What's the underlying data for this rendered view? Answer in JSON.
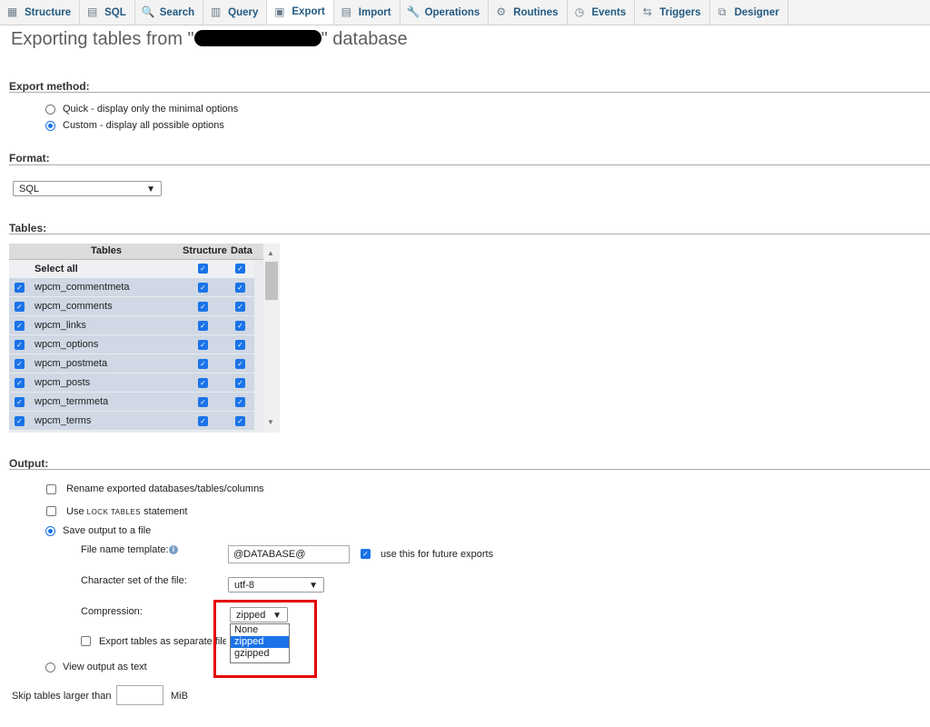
{
  "nav": {
    "tabs": [
      {
        "label": "Structure",
        "icon": "structure-icon",
        "glyph": "▦"
      },
      {
        "label": "SQL",
        "icon": "sql-icon",
        "glyph": "▤"
      },
      {
        "label": "Search",
        "icon": "search-icon",
        "glyph": "🔍"
      },
      {
        "label": "Query",
        "icon": "query-icon",
        "glyph": "▥"
      },
      {
        "label": "Export",
        "icon": "export-icon",
        "glyph": "▣"
      },
      {
        "label": "Import",
        "icon": "import-icon",
        "glyph": "▤"
      },
      {
        "label": "Operations",
        "icon": "wrench-icon",
        "glyph": "🔧"
      },
      {
        "label": "Routines",
        "icon": "routines-icon",
        "glyph": "⚙"
      },
      {
        "label": "Events",
        "icon": "clock-icon",
        "glyph": "◷"
      },
      {
        "label": "Triggers",
        "icon": "triggers-icon",
        "glyph": "⇆"
      },
      {
        "label": "Designer",
        "icon": "designer-icon",
        "glyph": "⧉"
      }
    ],
    "active": "Export"
  },
  "page": {
    "title_prefix": "Exporting tables from \"",
    "title_suffix": "\" database"
  },
  "export_method": {
    "heading": "Export method:",
    "quick_label": "Quick - display only the minimal options",
    "custom_label": "Custom - display all possible options",
    "selected": "custom"
  },
  "format": {
    "heading": "Format:",
    "value": "SQL"
  },
  "tables": {
    "heading": "Tables:",
    "col_tables": "Tables",
    "col_structure": "Structure",
    "col_data": "Data",
    "select_all": "Select all",
    "rows": [
      "wpcm_commentmeta",
      "wpcm_comments",
      "wpcm_links",
      "wpcm_options",
      "wpcm_postmeta",
      "wpcm_posts",
      "wpcm_termmeta",
      "wpcm_terms"
    ]
  },
  "output": {
    "heading": "Output:",
    "rename_label": "Rename exported databases/tables/columns",
    "lock_prefix": "Use ",
    "lock_code": "LOCK TABLES",
    "lock_suffix": " statement",
    "save_label": "Save output to a file",
    "filename_label": "File name template:",
    "filename_value": "@DATABASE@",
    "future_label": "use this for future exports",
    "charset_label": "Character set of the file:",
    "charset_value": "utf-8",
    "compression_label": "Compression:",
    "compression_value": "zipped",
    "compression_options": [
      "None",
      "zipped",
      "gzipped"
    ],
    "separate_label": "Export tables as separate files",
    "view_text_label": "View output as text"
  },
  "skip": {
    "label": "Skip tables larger than",
    "unit": "MiB",
    "value": ""
  },
  "colors": {
    "accent": "#1a73e8",
    "highlight": "#e30000",
    "tab_text": "#235a81"
  }
}
